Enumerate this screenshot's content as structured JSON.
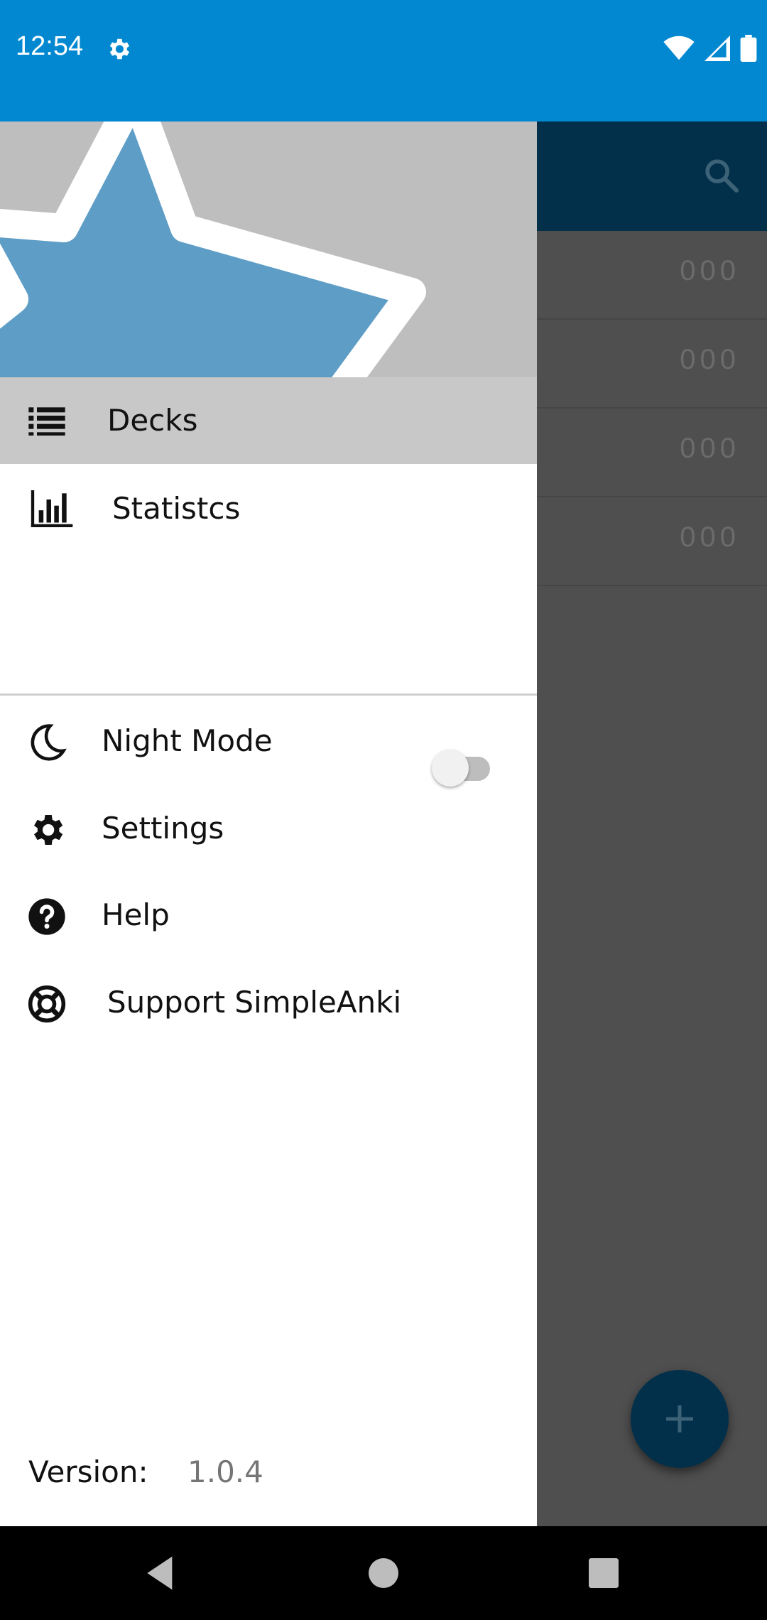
{
  "status_bar": {
    "time": "12:54"
  },
  "background_app": {
    "rows": [
      {
        "count": "000"
      },
      {
        "count": "000"
      },
      {
        "count": "000"
      },
      {
        "count": "000"
      }
    ]
  },
  "drawer": {
    "items": [
      {
        "label": "Decks",
        "icon": "list-icon",
        "selected": true
      },
      {
        "label": "Statistcs",
        "icon": "bar-chart-icon"
      },
      {
        "label": "Night Mode",
        "icon": "moon-icon",
        "toggle": false
      },
      {
        "label": "Settings",
        "icon": "gear-icon"
      },
      {
        "label": "Help",
        "icon": "help-icon"
      },
      {
        "label": "Support SimpleAnki",
        "icon": "lifebuoy-icon"
      }
    ],
    "version_label": "Version:",
    "version_value": "1.0.4"
  },
  "colors": {
    "status_bar": "#0288d1",
    "star_blue": "#5e9dc6",
    "selected_item": "#c8c8c8",
    "scrim": "#4f4f4f"
  }
}
